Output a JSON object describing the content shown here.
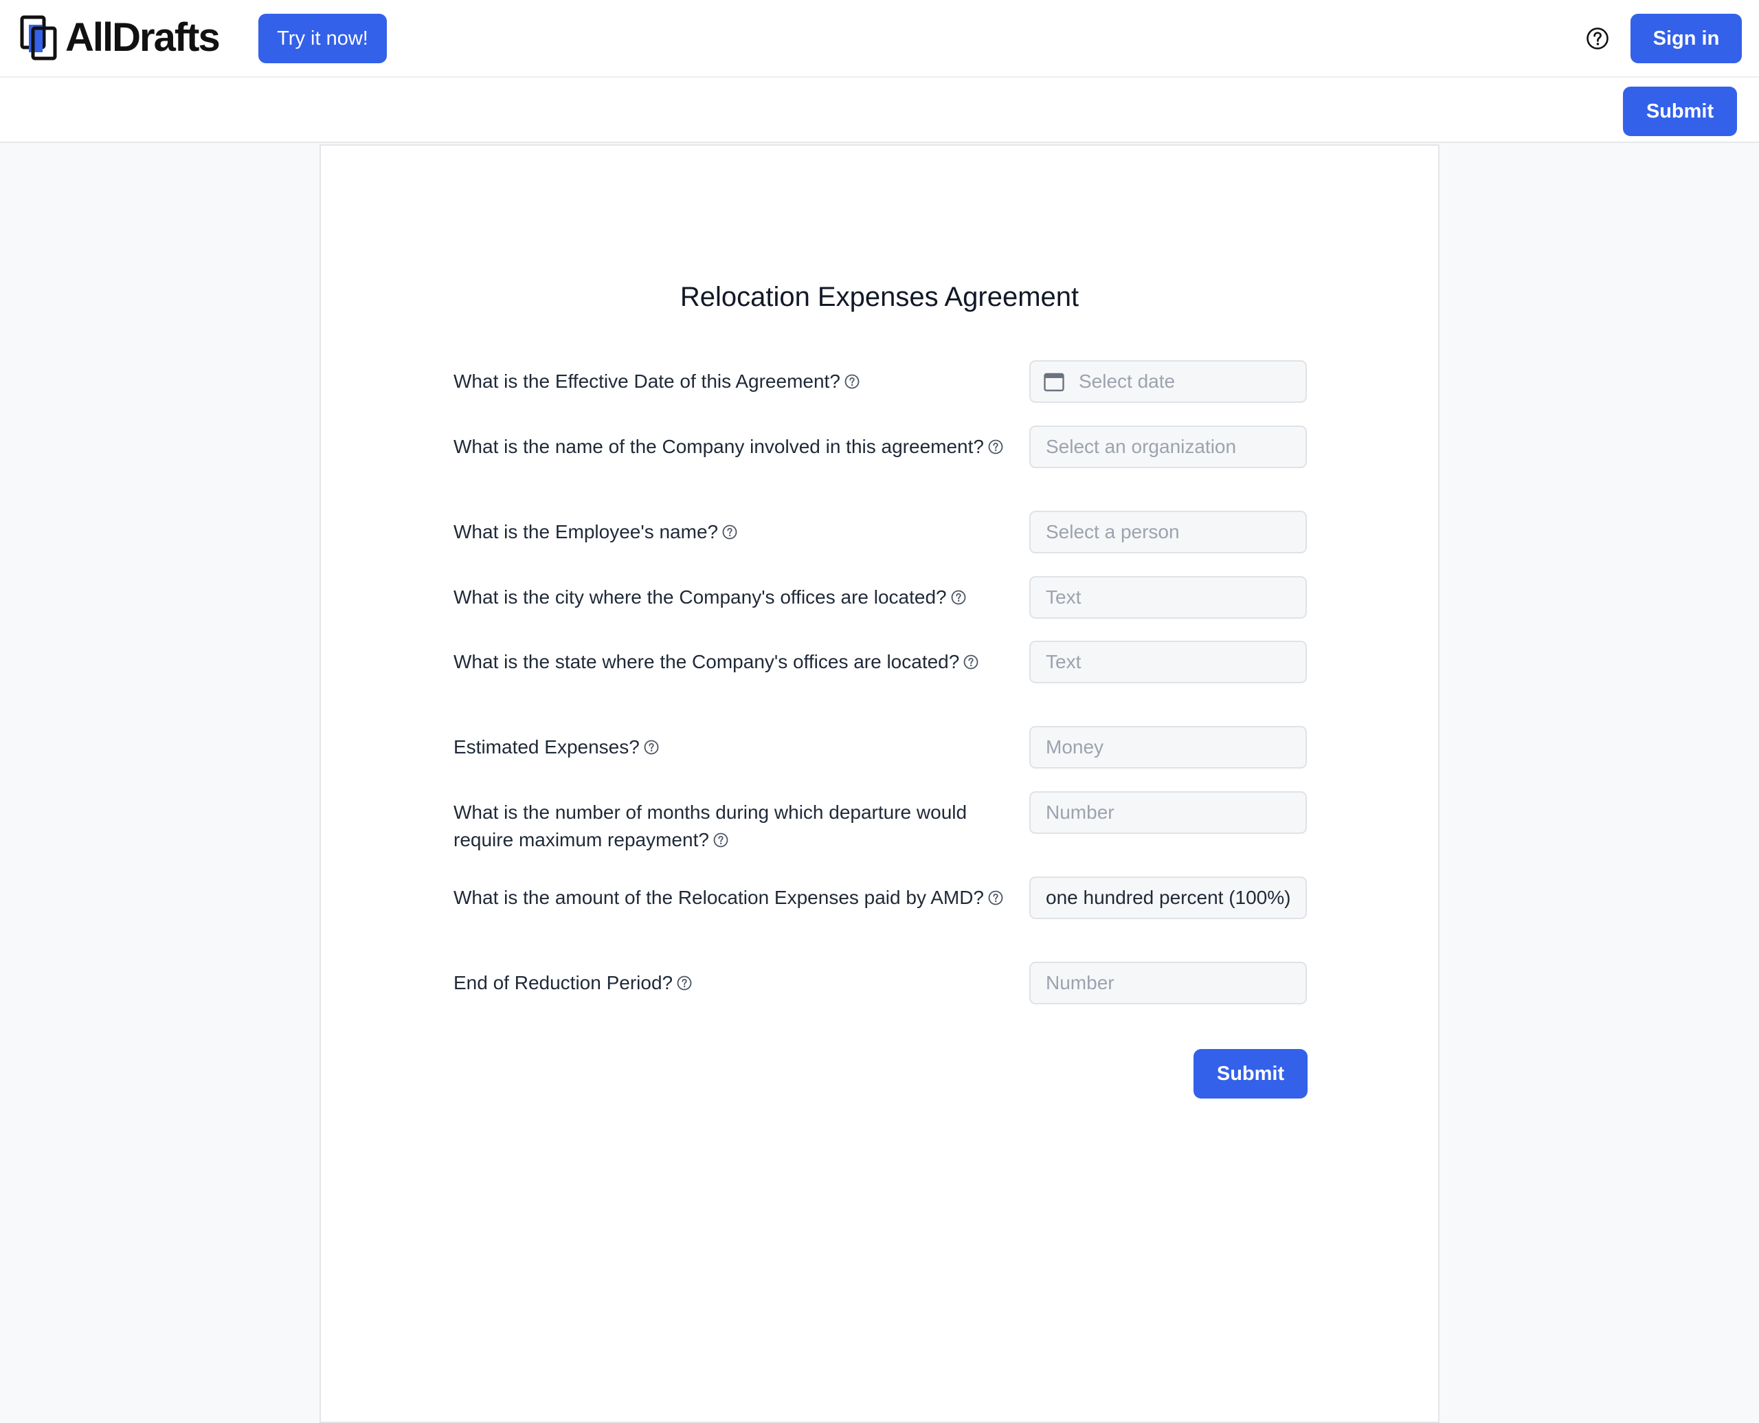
{
  "header": {
    "brand": "AllDrafts",
    "try_label": "Try it now!",
    "signin_label": "Sign in",
    "help_icon": "question-circle-icon"
  },
  "toolbar": {
    "submit_label": "Submit"
  },
  "colors": {
    "primary": "#3461ea",
    "background": "#f8f9fb",
    "field_background": "#f6f7f9",
    "field_border": "#dfe2e7"
  },
  "form": {
    "title": "Relocation Expenses Agreement",
    "questions": [
      {
        "label": "What is the Effective Date of this Agreement?",
        "placeholder": "Select date",
        "value": "",
        "icon": "calendar-icon"
      },
      {
        "label": "What is the name of the Company involved in this agreement?",
        "placeholder": "Select an organization",
        "value": ""
      },
      {
        "label": "What is the Employee's name?",
        "placeholder": "Select a person",
        "value": ""
      },
      {
        "label": "What is the city where the Company's offices are located?",
        "placeholder": "Text",
        "value": ""
      },
      {
        "label": "What is the state where the Company's offices are located?",
        "placeholder": "Text",
        "value": ""
      },
      {
        "label": "Estimated Expenses?",
        "placeholder": "Money",
        "value": ""
      },
      {
        "label": "What is the number of months during which departure would require maximum repayment?",
        "placeholder": "Number",
        "value": ""
      },
      {
        "label": "What is the amount of the Relocation Expenses paid by AMD?",
        "placeholder": "",
        "value": "one hundred percent (100%)"
      },
      {
        "label": "End of Reduction Period?",
        "placeholder": "Number",
        "value": ""
      }
    ],
    "submit_label": "Submit"
  }
}
